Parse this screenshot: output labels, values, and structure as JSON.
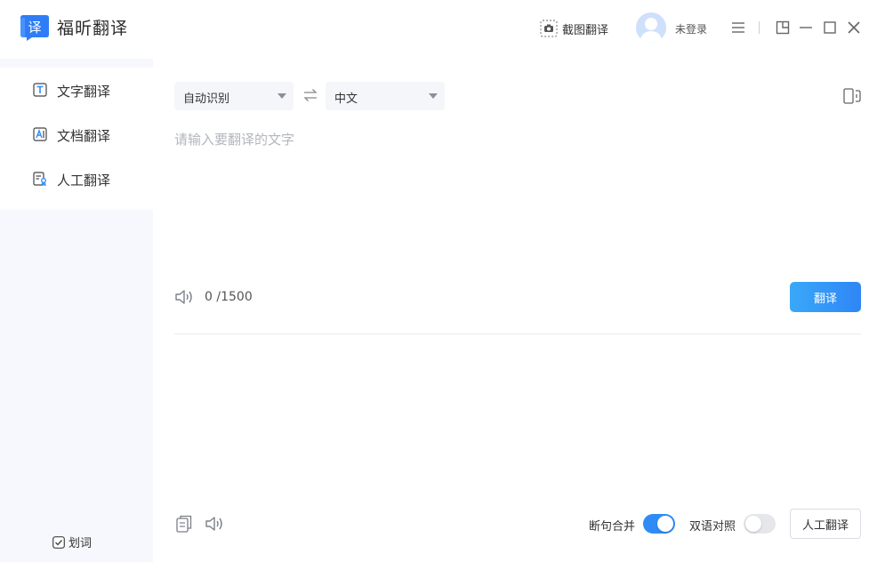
{
  "titlebar": {
    "app_name": "福昕翻译",
    "logo_glyph": "译",
    "screenshot_translate": "截图翻译",
    "login_status": "未登录"
  },
  "sidebar": {
    "items": [
      {
        "label": "文字翻译",
        "icon": "text-translate-icon",
        "active": true
      },
      {
        "label": "文档翻译",
        "icon": "document-translate-icon",
        "active": false
      },
      {
        "label": "人工翻译",
        "icon": "human-translate-icon",
        "active": false
      }
    ],
    "word_pick": {
      "label": "划词",
      "checked": true
    }
  },
  "main": {
    "source_lang": "自动识别",
    "target_lang": "中文",
    "input_placeholder": "请输入要翻译的文字",
    "input_value": "",
    "char_count": "0",
    "char_limit": "/1500",
    "translate_button": "翻译",
    "sentence_merge": {
      "label": "断句合并",
      "on": true
    },
    "bilingual": {
      "label": "双语对照",
      "on": false
    },
    "human_translate_button": "人工翻译"
  },
  "colors": {
    "accent": "#2f8cf6",
    "sidebar_bg": "#f6f8fd",
    "logo_blue": "#2e7df6"
  }
}
